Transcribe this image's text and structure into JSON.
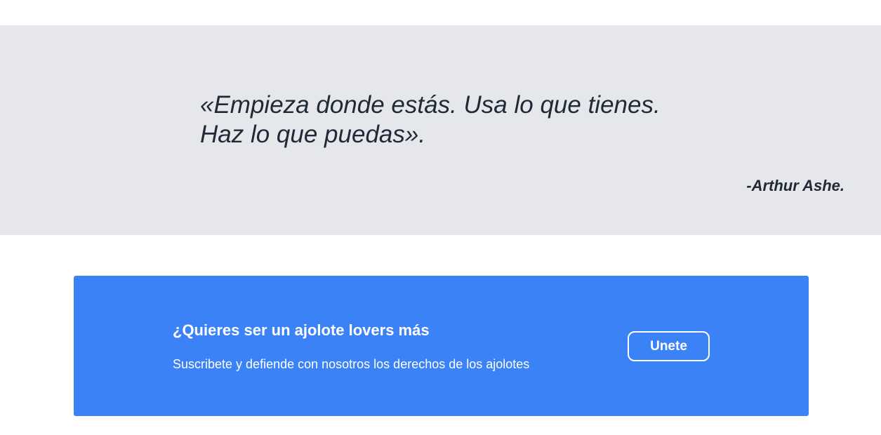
{
  "quote": {
    "line1": "«Empieza donde estás. Usa lo que tienes.",
    "line2": "Haz lo que puedas».",
    "author": "-Arthur Ashe."
  },
  "cta": {
    "title": "¿Quieres ser un ajolote lovers más",
    "subtitle": "Suscribete y defiende con nosotros los derechos de los ajolotes",
    "button_label": "Unete"
  },
  "colors": {
    "quote_background": "#e5e7eb",
    "quote_text": "#1f2937",
    "cta_background": "#3b82f6",
    "cta_text": "#ffffff"
  }
}
